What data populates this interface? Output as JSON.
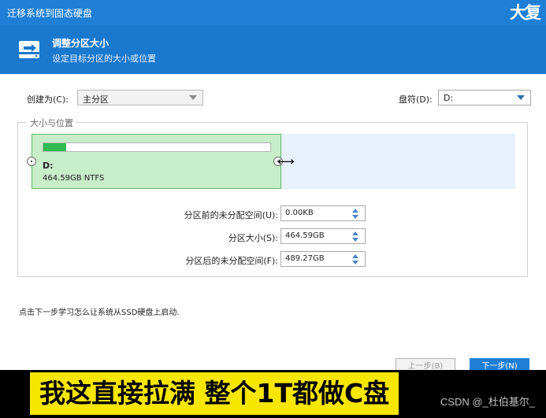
{
  "window": {
    "title": "迁移系统到固态硬盘",
    "logo_text": "大复"
  },
  "banner": {
    "heading": "调整分区大小",
    "subheading": "设定目标分区的大小或位置",
    "icon": "disk-migrate-icon"
  },
  "create_as": {
    "label": "创建为(C):",
    "value": "主分区"
  },
  "drive_letter": {
    "label": "盘符(D):",
    "value": "D:"
  },
  "size_position": {
    "legend": "大小与位置",
    "partition": {
      "name": "D:",
      "info": "464.59GB NTFS",
      "used_fraction": 0.1
    }
  },
  "fields": [
    {
      "label": "分区前的未分配空间(U):",
      "value": "0.00KB"
    },
    {
      "label": "分区大小(S):",
      "value": "464.59GB"
    },
    {
      "label": "分区后的未分配空间(F):",
      "value": "489.27GB"
    }
  ],
  "hint": "点击下一步学习怎么让系统从SSD硬盘上启动.",
  "buttons": {
    "prev": "上一步(B)",
    "next": "下一步(N)"
  },
  "caption": "我这直接拉满  整个1T都做C盘",
  "watermark": "CSDN @_杜伯基尔_",
  "colors": {
    "accent": "#1f7fd6",
    "partition_fill": "#c7edc9",
    "usage_fill": "#2fba52",
    "caption_bg": "#f7e600"
  }
}
